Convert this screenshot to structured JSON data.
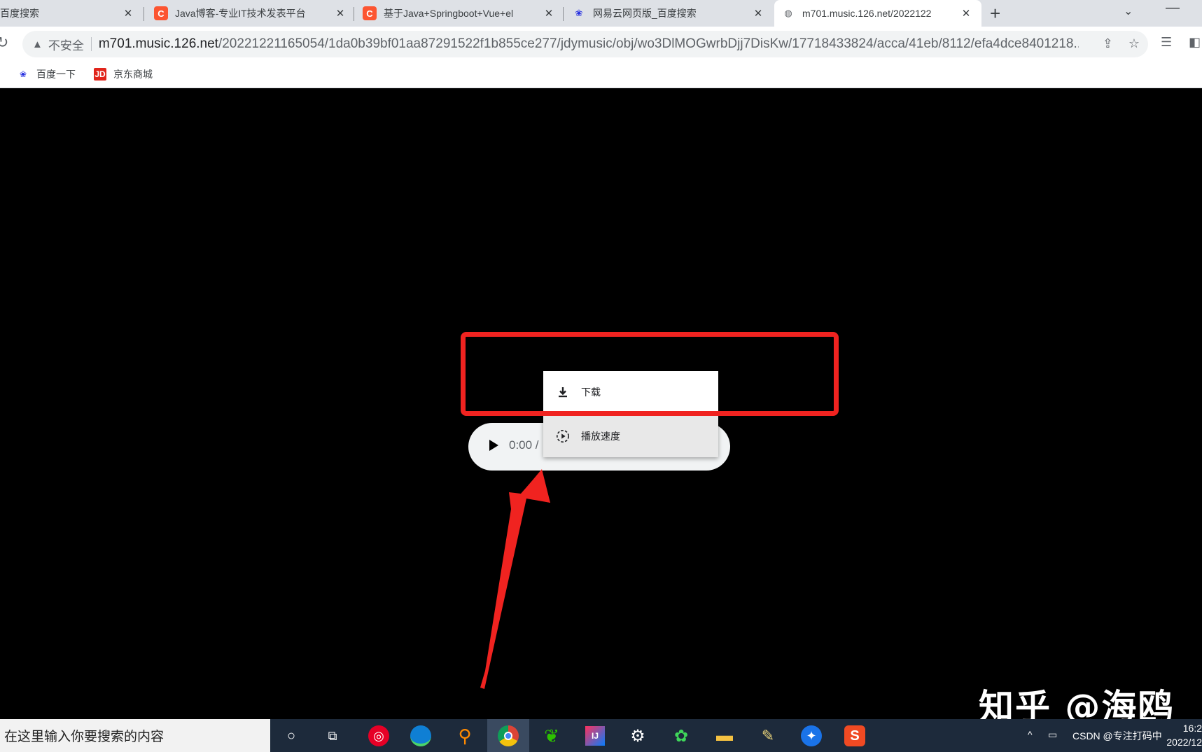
{
  "browser": {
    "tabs": [
      {
        "title": "百度搜索",
        "favicon": "none",
        "active": false
      },
      {
        "title": "Java博客-专业IT技术发表平台",
        "favicon": "csdn-icon",
        "active": false
      },
      {
        "title": "基于Java+Springboot+Vue+el",
        "favicon": "csdn-icon",
        "active": false
      },
      {
        "title": "网易云网页版_百度搜索",
        "favicon": "baidu-paw-icon",
        "active": false
      },
      {
        "title": "m701.music.126.net/2022122",
        "favicon": "globe-icon",
        "active": true
      }
    ],
    "security_label": "不安全",
    "url_host": "m701.music.126.net",
    "url_path": "/20221221165054/1da0b39bf01aa87291522f1b855ce277/jdymusic/obj/wo3DlMOGwrbDjj7DisKw/17718433824/acca/41eb/8112/efa4dce8401218...",
    "bookmarks": [
      {
        "label": "百度一下",
        "icon": "baidu-paw-icon"
      },
      {
        "label": "京东商城",
        "icon": "jd-icon"
      }
    ]
  },
  "player": {
    "time": "0:00 /"
  },
  "context_menu": {
    "items": [
      {
        "label": "下载",
        "icon": "download-icon"
      },
      {
        "label": "播放速度",
        "icon": "playback-speed-icon"
      }
    ]
  },
  "watermark": "知乎 @海鸥",
  "taskbar": {
    "search_placeholder": "在这里输入你要搜索的内容",
    "tray_text": "CSDN @专注打码中",
    "clock_time": "16:2",
    "clock_date": "2022/12"
  },
  "colors": {
    "highlight": "#f02320",
    "content_bg": "#000000",
    "taskbar_bg": "#1d2a3b"
  }
}
